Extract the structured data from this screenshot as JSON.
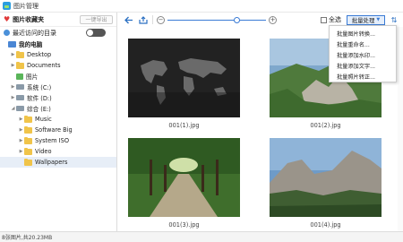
{
  "window": {
    "title": "图片管理"
  },
  "sidebar": {
    "favorites_label": "图片收藏夹",
    "export_button": "一键导出",
    "recent_label": "最近访问的目录",
    "tree": [
      {
        "label": "我的电脑",
        "icon": "computer-icon",
        "level": 0,
        "arrow": ""
      },
      {
        "label": "Desktop",
        "icon": "folder-icon",
        "level": 1,
        "arrow": "▶"
      },
      {
        "label": "Documents",
        "icon": "folder-icon",
        "level": 1,
        "arrow": "▶"
      },
      {
        "label": "图片",
        "icon": "image-folder-icon",
        "level": 1,
        "arrow": ""
      },
      {
        "label": "系统 (C:)",
        "icon": "drive-icon",
        "level": 1,
        "arrow": "▶"
      },
      {
        "label": "软件 (D:)",
        "icon": "drive-icon",
        "level": 1,
        "arrow": "▶"
      },
      {
        "label": "综合 (E:)",
        "icon": "drive-icon",
        "level": 1,
        "arrow": "◢"
      },
      {
        "label": "Music",
        "icon": "folder-icon",
        "level": 2,
        "arrow": "▶"
      },
      {
        "label": "Software Big",
        "icon": "folder-icon",
        "level": 2,
        "arrow": "▶"
      },
      {
        "label": "System ISO",
        "icon": "folder-icon",
        "level": 2,
        "arrow": "▶"
      },
      {
        "label": "Video",
        "icon": "folder-icon",
        "level": 2,
        "arrow": "▶"
      },
      {
        "label": "Wallpapers",
        "icon": "folder-icon",
        "level": 2,
        "arrow": "",
        "selected": true
      }
    ]
  },
  "toolbar": {
    "select_all": "全选",
    "batch_label": "批量处理",
    "zoom_level": 0.72
  },
  "batch_menu": [
    "批量图片转换...",
    "批量重命名...",
    "批量添加水印...",
    "批量添加文字...",
    "批量照片转正..."
  ],
  "images": [
    {
      "name": "001(1).jpg"
    },
    {
      "name": "001(2).jpg"
    },
    {
      "name": "001(3).jpg"
    },
    {
      "name": "001(4).jpg"
    }
  ],
  "status": {
    "text": "8张图片,共20.23MB"
  },
  "colors": {
    "accent": "#3a7bd5",
    "heart": "#e03a3a",
    "selected_row": "#e7eef7"
  }
}
